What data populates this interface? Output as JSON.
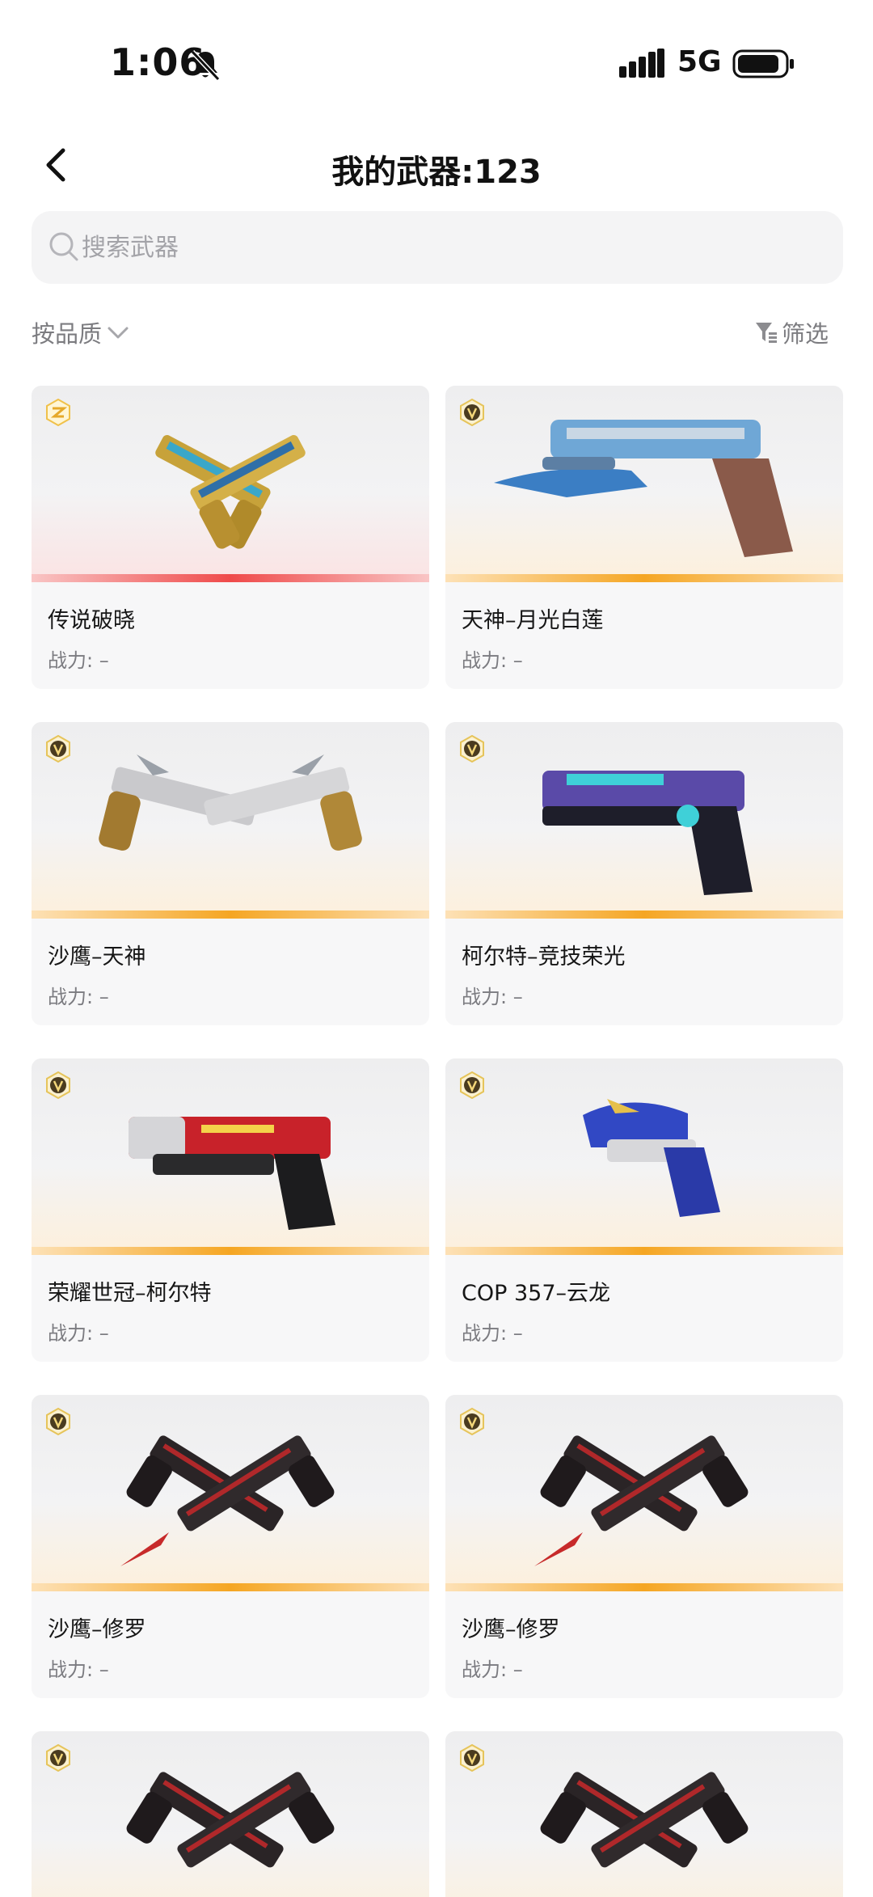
{
  "status": {
    "time": "1:06",
    "network": "5G"
  },
  "header": {
    "title": "我的武器:123"
  },
  "search": {
    "placeholder": "搜索武器"
  },
  "filters": {
    "sort_label": "按品质",
    "filter_label": "筛选"
  },
  "cards": [
    {
      "name": "传说破晓",
      "power": "战力: –",
      "tier": "legendary",
      "icon": "crossed-pistols-gold-icon"
    },
    {
      "name": "天神–月光白莲",
      "power": "战力: –",
      "tier": "v",
      "icon": "pistol-blade-icon"
    },
    {
      "name": "沙鹰–天神",
      "power": "战力: –",
      "tier": "v",
      "icon": "crossed-pistols-icon"
    },
    {
      "name": "柯尔特–竞技荣光",
      "power": "战力: –",
      "tier": "v",
      "icon": "pistol-icon"
    },
    {
      "name": "荣耀世冠–柯尔特",
      "power": "战力: –",
      "tier": "v",
      "icon": "pistol-icon"
    },
    {
      "name": "COP 357–云龙",
      "power": "战力: –",
      "tier": "v",
      "icon": "pistol-icon"
    },
    {
      "name": "沙鹰–修罗",
      "power": "战力: –",
      "tier": "v",
      "icon": "crossed-pistols-icon"
    },
    {
      "name": "沙鹰–修罗",
      "power": "战力: –",
      "tier": "v",
      "icon": "crossed-pistols-icon"
    },
    {
      "name": "",
      "power": "",
      "tier": "v",
      "icon": "crossed-pistols-icon"
    },
    {
      "name": "",
      "power": "",
      "tier": "v",
      "icon": "crossed-pistols-icon"
    }
  ],
  "colors": {
    "legendary_accent": "#ef4a4a",
    "v_accent": "#f5a623",
    "card_bg": "#f7f7f8",
    "muted_text": "#7b7b80"
  }
}
